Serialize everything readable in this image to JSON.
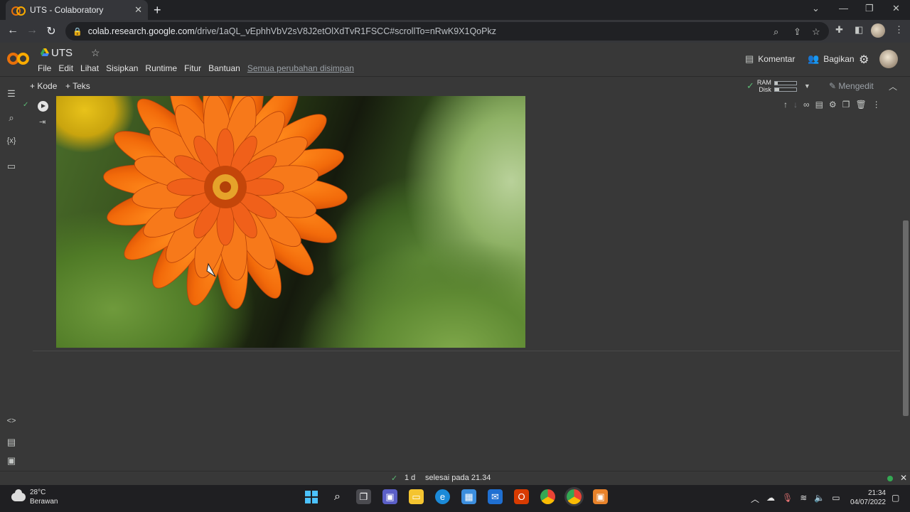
{
  "browser": {
    "tab_title": "UTS - Colaboratory",
    "tab_close": "✕",
    "new_tab": "+",
    "url_host": "colab.research.google.com",
    "url_path": "/drive/1aQL_vEphhVbV2sV8J2etOlXdTvR1FSCC#scrollTo=nRwK9X1QoPkz"
  },
  "colab": {
    "notebook_title": "UTS",
    "menu": [
      "File",
      "Edit",
      "Lihat",
      "Sisipkan",
      "Runtime",
      "Fitur",
      "Bantuan"
    ],
    "saved_status": "Semua perubahan disimpan",
    "comment_label": "Komentar",
    "share_label": "Bagikan"
  },
  "toolbar": {
    "add_code": "+ Kode",
    "add_text": "+ Teks",
    "ram_label": "RAM",
    "disk_label": "Disk",
    "ram_usage": 0.15,
    "disk_usage": 0.2,
    "editing_label": "Mengedit"
  },
  "cell": {
    "output_image": "orange-zinnia-flower-photo"
  },
  "statusbar": {
    "duration": "1 d",
    "finished_text": "selesai pada 21.34"
  },
  "taskbar": {
    "temperature": "28°C",
    "weather": "Berawan",
    "time": "21:34",
    "date": "04/07/2022"
  },
  "colors": {
    "accent_orange": "#e8710a",
    "accent_yellow": "#f9ab00",
    "success_green": "#34a853"
  }
}
